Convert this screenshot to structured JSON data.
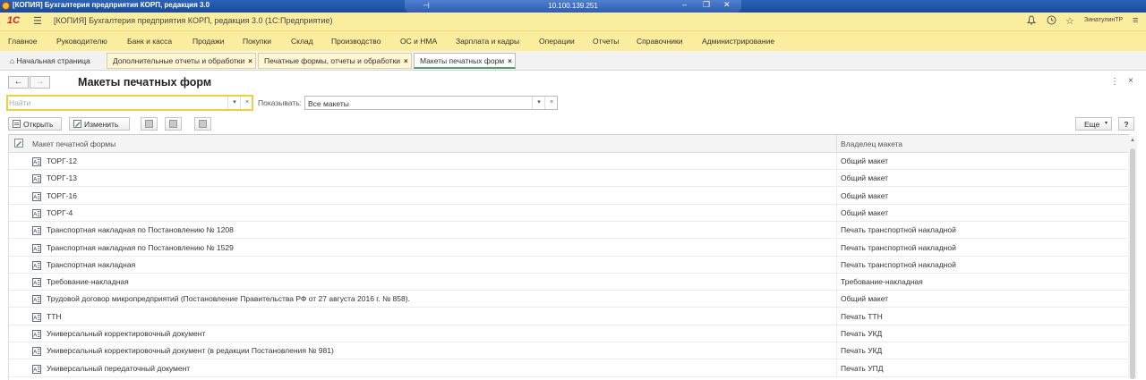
{
  "window": {
    "title": "[КОПИЯ] Бухгалтерия предприятия КОРП, редакция 3.0",
    "remote_ip": "10.100.139.251"
  },
  "app_header": {
    "logo": "1С",
    "title": "[КОПИЯ] Бухгалтерия предприятия КОРП, редакция 3.0  (1С:Предприятие)",
    "user": "ЗинатулинТР"
  },
  "menu": {
    "items": [
      "Главное",
      "Руководителю",
      "Банк и касса",
      "Продажи",
      "Покупки",
      "Склад",
      "Производство",
      "ОС и НМА",
      "Зарплата и кадры",
      "Операции",
      "Отчеты",
      "Справочники",
      "Администрирование"
    ]
  },
  "tabs": {
    "home": "Начальная страница",
    "items": [
      {
        "label": "Дополнительные отчеты и обработки"
      },
      {
        "label": "Печатные формы, отчеты и обработки"
      },
      {
        "label": "Макеты печатных форм"
      }
    ]
  },
  "form": {
    "title": "Макеты печатных форм",
    "search_placeholder": "Найти",
    "show_label": "Показывать:",
    "show_value": "Все макеты"
  },
  "toolbar": {
    "open": "Открыть",
    "edit": "Изменить",
    "more": "Еще",
    "help": "?"
  },
  "table": {
    "columns": [
      "Макет печатной формы",
      "Владелец макета"
    ],
    "rows": [
      {
        "name": "ТОРГ-12",
        "owner": "Общий макет"
      },
      {
        "name": "ТОРГ-13",
        "owner": "Общий макет"
      },
      {
        "name": "ТОРГ-16",
        "owner": "Общий макет"
      },
      {
        "name": "ТОРГ-4",
        "owner": "Общий макет"
      },
      {
        "name": "Транспортная накладная по Постановлению № 1208",
        "owner": "Печать транспортной накладной"
      },
      {
        "name": "Транспортная накладная по Постановлению № 1529",
        "owner": "Печать транспортной накладной"
      },
      {
        "name": "Транспортная накладная",
        "owner": "Печать транспортной накладной"
      },
      {
        "name": "Требование-накладная",
        "owner": "Требование-накладная"
      },
      {
        "name": "Трудовой договор микропредприятий (Постановление Правительства РФ от 27 августа 2016 г. № 858).",
        "owner": "Общий макет"
      },
      {
        "name": "ТТН",
        "owner": "Печать ТТН"
      },
      {
        "name": "Универсальный корректировочный документ",
        "owner": "Печать УКД"
      },
      {
        "name": "Универсальный корректировочный документ (в редакции Постановления № 981)",
        "owner": "Печать УКД"
      },
      {
        "name": "Универсальный передаточный документ",
        "owner": "Печать УПД"
      }
    ]
  }
}
